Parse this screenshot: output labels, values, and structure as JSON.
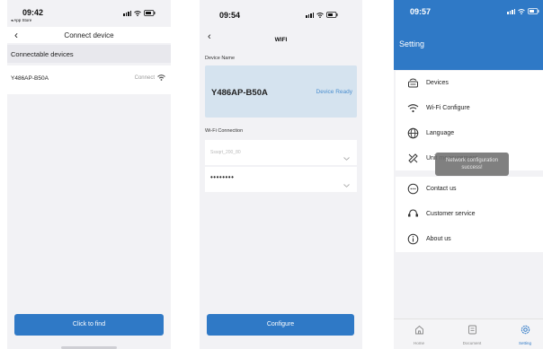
{
  "screen1": {
    "time": "09:42",
    "back_to": "◂ App Store",
    "title": "Connect device",
    "section": "Connectable devices",
    "device_name": "Y486AP-B50A",
    "device_action": "Connect",
    "button": "Click to find"
  },
  "screen2": {
    "time": "09:54",
    "title": "WIFI",
    "device_name_label": "Device Name",
    "device_name": "Y486AP-B50A",
    "device_status": "Device Ready",
    "wifi_label": "Wi-Fi Connection",
    "ssid_value": "Sssqrt_200_80",
    "password_value": "••••••••",
    "button": "Configure"
  },
  "screen3": {
    "time": "09:57",
    "title": "Setting",
    "menu": [
      {
        "label": "Devices",
        "icon": "router-icon"
      },
      {
        "label": "Wi-Fi Configure",
        "icon": "wifi-icon"
      },
      {
        "label": "Language",
        "icon": "globe-icon"
      },
      {
        "label": "Unit measurement",
        "icon": "ruler-icon"
      }
    ],
    "menu2": [
      {
        "label": "Contact us",
        "icon": "chat-icon"
      },
      {
        "label": "Customer service",
        "icon": "headset-icon"
      },
      {
        "label": "About us",
        "icon": "info-icon"
      }
    ],
    "toast": "Network configuration success!",
    "tabs": [
      {
        "label": "Home",
        "icon": "home-icon",
        "active": false
      },
      {
        "label": "Document",
        "icon": "document-icon",
        "active": false
      },
      {
        "label": "Setting",
        "icon": "gear-icon",
        "active": true
      }
    ]
  },
  "colors": {
    "accent": "#2f79c6",
    "background": "#f2f2f5",
    "card": "#d5e3ef"
  }
}
